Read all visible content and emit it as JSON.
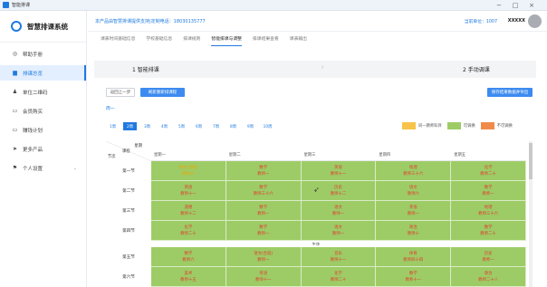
{
  "window": {
    "title": "智能排课",
    "minimize": "−",
    "maximize": "□",
    "close": "×"
  },
  "brand": {
    "name": "智慧排课系统"
  },
  "sidebar": {
    "items": [
      {
        "label": "帮助手册",
        "icon": "help-icon",
        "glyph": "◎"
      },
      {
        "label": "排课总览",
        "icon": "schedule-icon",
        "glyph": "▆",
        "active": true
      },
      {
        "label": "单位二维码",
        "icon": "user-icon",
        "glyph": "♟"
      },
      {
        "label": "会员购买",
        "icon": "monitor-icon",
        "glyph": "▭"
      },
      {
        "label": "赚钱计划",
        "icon": "monitor-icon",
        "glyph": "▭"
      },
      {
        "label": "更多产品",
        "icon": "send-icon",
        "glyph": "➤"
      },
      {
        "label": "个人设置",
        "icon": "flag-icon",
        "glyph": "⚑",
        "chevron": "⌄"
      }
    ]
  },
  "header": {
    "company": "本产品由智慧排课提供支持|定制电话：18030135777",
    "unit": "当前单位：1007",
    "username": "XXXXX"
  },
  "tabs": [
    "课表时间基础信息",
    "学校基础信息",
    "排课规则",
    "智能排课与调整",
    "排课结果查看",
    "课表输出"
  ],
  "active_tab": 3,
  "steps": {
    "step1": "1 智能排课",
    "step2": "2 手动调课"
  },
  "buttons": {
    "prev": "返回上一步",
    "reset": "刷新重新排课程",
    "save": "保存结果数据并导出"
  },
  "clock": {
    "label": "周一"
  },
  "weeks": {
    "items": [
      "1周",
      "2周",
      "3周",
      "4周",
      "5周",
      "6周",
      "7周",
      "8周",
      "9周",
      "10周"
    ],
    "active": 1
  },
  "legend": [
    {
      "label": "同一教师科目",
      "color": "#f7c34a"
    },
    {
      "label": "可调换",
      "color": "#9dcc66"
    },
    {
      "label": "不可调换",
      "color": "#f08a4b"
    }
  ],
  "colors": {
    "accent": "#1f7ae0",
    "cell_green": "#9dcc66"
  },
  "grid": {
    "corner": {
      "weekday": "星期",
      "course": "课程",
      "period": "节次"
    },
    "days": [
      "星期一",
      "星期二",
      "星期三",
      "星期四",
      "星期五"
    ],
    "noon": "午休",
    "periods": [
      {
        "name": "第一节",
        "cells": [
          {
            "subject": "语文(合班)",
            "teacher": "教师六",
            "style": "orange"
          },
          {
            "subject": "数学",
            "teacher": "教师一"
          },
          {
            "subject": "英语",
            "teacher": "教师十一"
          },
          {
            "subject": "地理",
            "teacher": "教师三十六"
          },
          {
            "subject": "化学",
            "teacher": "教师二十"
          }
        ]
      },
      {
        "name": "第二节",
        "cells": [
          {
            "subject": "英语",
            "teacher": "教师十一"
          },
          {
            "subject": "数学",
            "teacher": "教师三十六"
          },
          {
            "subject": "历史",
            "teacher": "教师十二"
          },
          {
            "subject": "语文",
            "teacher": "教师六"
          },
          {
            "subject": "数学",
            "teacher": "教师一"
          }
        ]
      },
      {
        "name": "第三节",
        "cells": [
          {
            "subject": "道德",
            "teacher": "教师十二"
          },
          {
            "subject": "数学",
            "teacher": "教师一"
          },
          {
            "subject": "语文",
            "teacher": "教师一"
          },
          {
            "subject": "英语",
            "teacher": "教师一"
          },
          {
            "subject": "地理",
            "teacher": "教师三十六"
          }
        ]
      },
      {
        "name": "第四节",
        "cells": [
          {
            "subject": "化学",
            "teacher": "教师二十"
          },
          {
            "subject": "数学",
            "teacher": "教师一"
          },
          {
            "subject": "语文",
            "teacher": "教师一"
          },
          {
            "subject": "政治",
            "teacher": "教师十"
          },
          {
            "subject": "数学",
            "teacher": "教师二十"
          }
        ]
      },
      {
        "name": "第五节",
        "noon_before": true,
        "cells": [
          {
            "subject": "数学",
            "teacher": "教师六"
          },
          {
            "subject": "语文(合班)",
            "teacher": "教师一"
          },
          {
            "subject": "音乐",
            "teacher": "教师十一"
          },
          {
            "subject": "体育",
            "teacher": "教师四十四"
          },
          {
            "subject": "历史",
            "teacher": "教师一"
          }
        ]
      },
      {
        "name": "第六节",
        "cells": [
          {
            "subject": "美术",
            "teacher": "教师十五"
          },
          {
            "subject": "英语",
            "teacher": "教师十一"
          },
          {
            "subject": "化学",
            "teacher": "教师二十"
          },
          {
            "subject": "数学",
            "teacher": "教师十一"
          },
          {
            "subject": "政治",
            "teacher": "教师二十八"
          }
        ]
      }
    ]
  }
}
